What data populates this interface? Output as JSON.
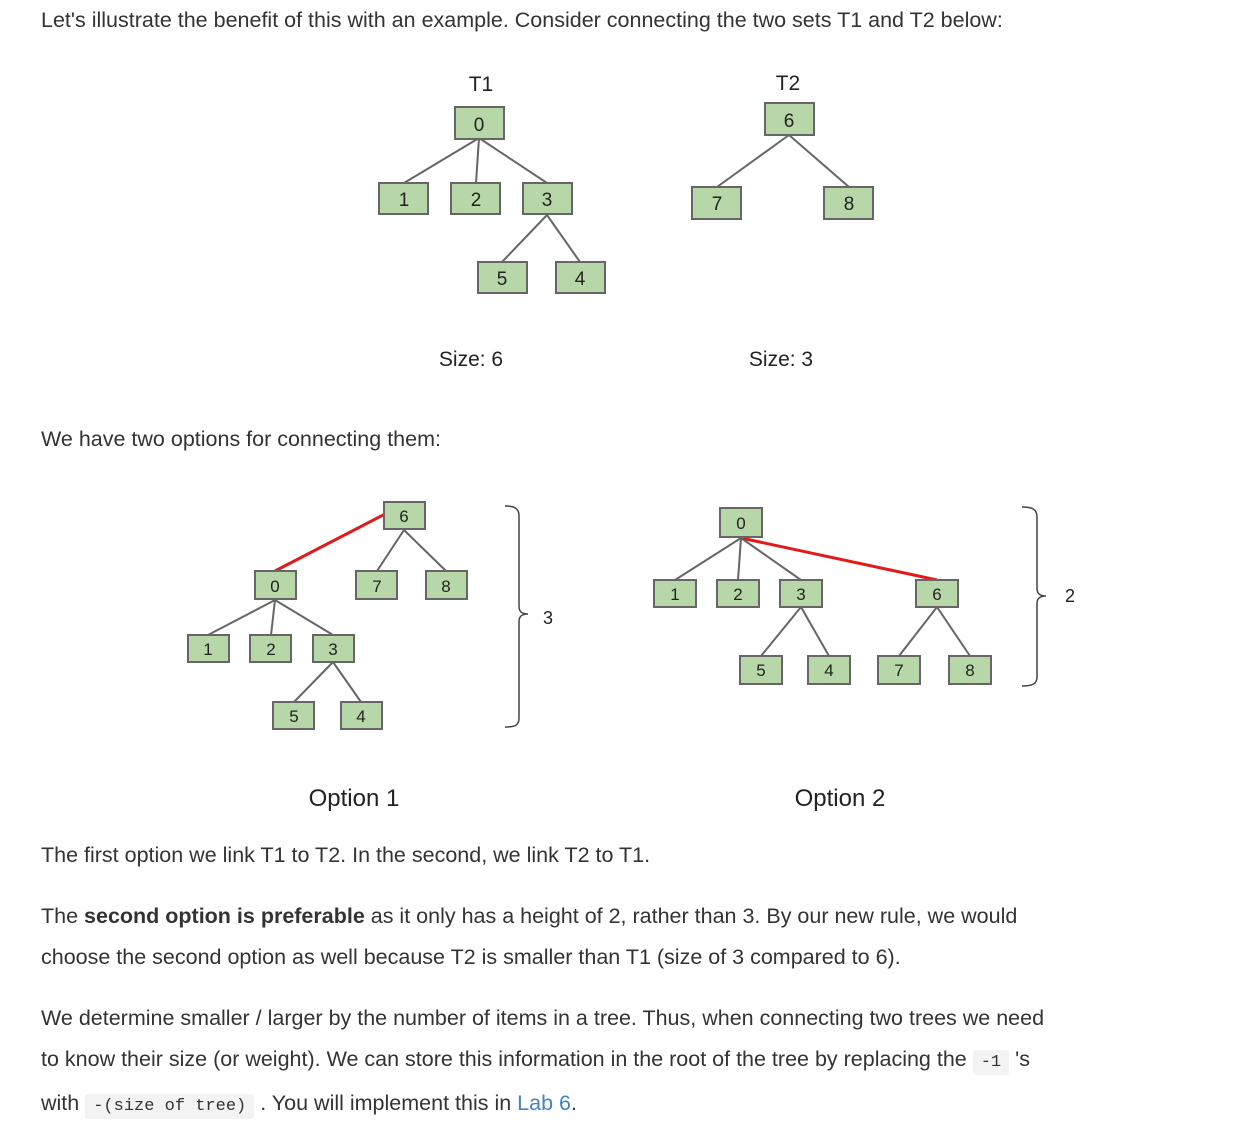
{
  "intro": "Let's illustrate the benefit of this with an example. Consider connecting the two sets T1 and T2 below:",
  "trees": {
    "t1_title": "T1",
    "t2_title": "T2",
    "t1_size": "Size: 6",
    "t2_size": "Size: 3"
  },
  "options_intro": "We have two options for connecting them:",
  "option1": {
    "label": "Option 1",
    "height": "3"
  },
  "option2": {
    "label": "Option 2",
    "height": "2"
  },
  "p1": "The first option we link T1 to T2. In the second, we link T2 to T1.",
  "p2": {
    "before": "The ",
    "bold": "second option is preferable",
    "line1_after": " as it only has a height of 2, rather than 3. By our new rule, we would",
    "line2": "choose the second option as well because T2 is smaller than T1 (size of 3 compared to 6)."
  },
  "p3": {
    "line1": "We determine smaller / larger by the number of items in a tree. Thus, when connecting two trees we need",
    "line2_before": "to know their size (or weight). We can store this information in the root of the tree by replacing the ",
    "code1": "-1",
    "line2_after": " 's",
    "line3_before": "with ",
    "code2": "-(size of tree)",
    "line3_mid": " . You will implement this in ",
    "link": "Lab 6",
    "line3_end": "."
  },
  "colors": {
    "node_fill": "#b7d7a8",
    "node_stroke": "#666666",
    "highlight_edge": "#e01b1b",
    "link": "#4183c4"
  },
  "nodes": {
    "t1": [
      "0",
      "1",
      "2",
      "3",
      "5",
      "4"
    ],
    "t2": [
      "6",
      "7",
      "8"
    ],
    "opt1": [
      "6",
      "0",
      "7",
      "8",
      "1",
      "2",
      "3",
      "5",
      "4"
    ],
    "opt2": [
      "0",
      "1",
      "2",
      "3",
      "6",
      "5",
      "4",
      "7",
      "8"
    ]
  }
}
